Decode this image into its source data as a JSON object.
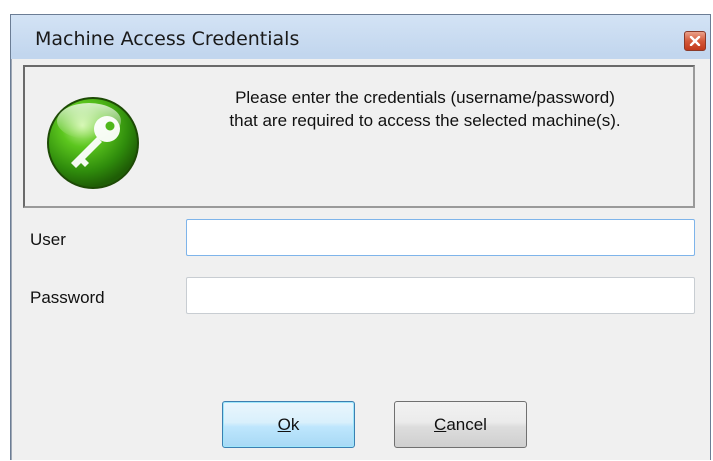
{
  "window": {
    "title": "Machine Access Credentials"
  },
  "info": {
    "icon": "key-icon",
    "message_line1": "Please enter the credentials (username/password)",
    "message_line2": "that are required to access the selected machine(s)."
  },
  "form": {
    "user_label": "User",
    "user_value": "",
    "password_label": "Password",
    "password_value": ""
  },
  "buttons": {
    "ok_mnemonic": "O",
    "ok_rest": "k",
    "cancel_mnemonic": "C",
    "cancel_rest": "ancel"
  },
  "colors": {
    "titlebar": "#c2d6ee",
    "close_button": "#d4593a",
    "client_background": "#f0f0f0",
    "icon_green": "#3aa514",
    "focus_border": "#7eb4ea"
  }
}
